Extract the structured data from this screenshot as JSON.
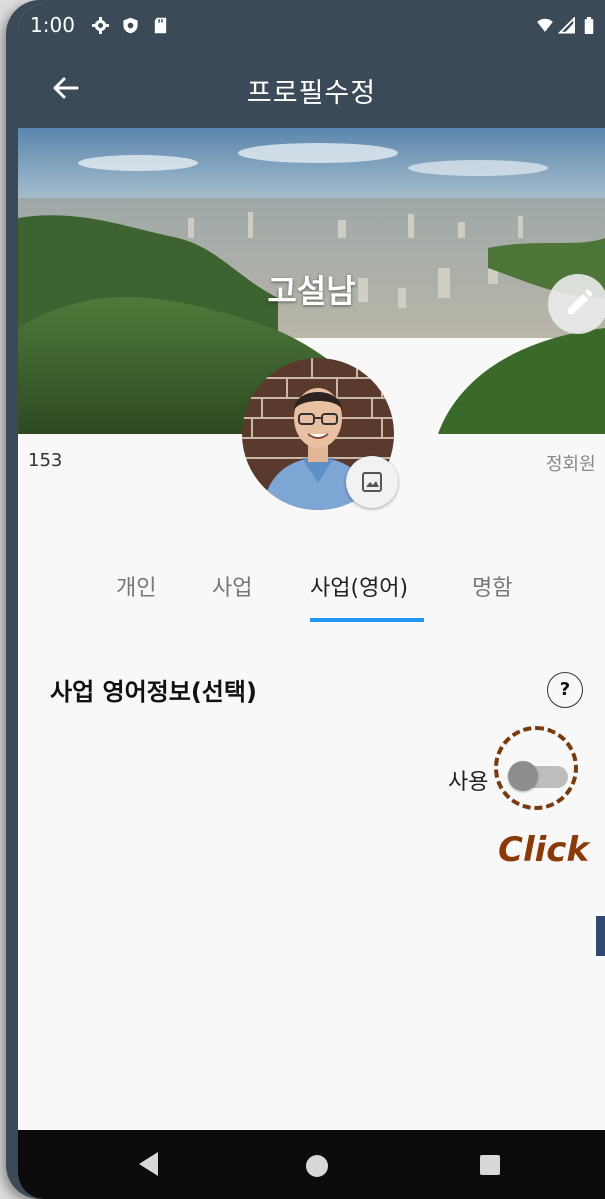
{
  "status_bar": {
    "time": "1:00"
  },
  "app_bar": {
    "title": "프로필수정"
  },
  "profile": {
    "name": "고설남",
    "member_number": "153",
    "member_grade": "정회원"
  },
  "tabs": [
    {
      "label": "개인",
      "active": false
    },
    {
      "label": "사업",
      "active": false
    },
    {
      "label": "사업(영어)",
      "active": true
    },
    {
      "label": "명함",
      "active": false
    }
  ],
  "section": {
    "title": "사업 영어정보(선택)",
    "help_label": "?",
    "toggle_label": "사용",
    "toggle_on": false
  },
  "annotation": {
    "label": "Click",
    "color": "#8a3a08"
  },
  "colors": {
    "app_bar": "#3b4a56",
    "tab_indicator": "#2196f3",
    "background": "#f8f8f8"
  },
  "icons": [
    "back-arrow-icon",
    "edit-pencil-icon",
    "image-icon",
    "settings-icon",
    "shield-icon",
    "sd-card-icon",
    "wifi-icon",
    "signal-icon",
    "battery-icon"
  ]
}
